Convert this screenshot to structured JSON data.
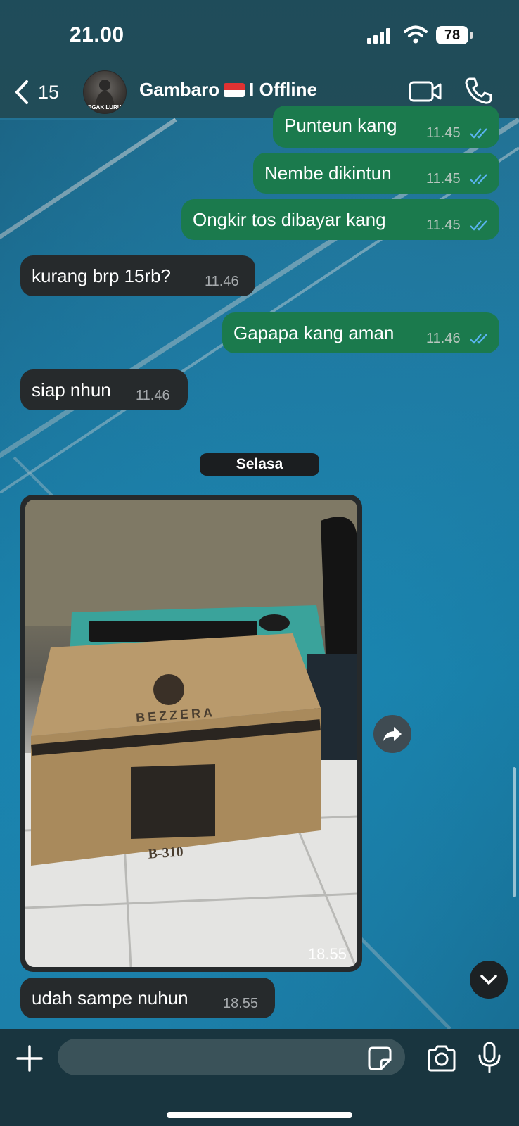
{
  "status_bar": {
    "time": "21.00",
    "battery": "78"
  },
  "header": {
    "back_count": "15",
    "contact_name": "Gambaro",
    "contact_status_suffix": "I Offline",
    "avatar_caption": "TEGAK LURUS"
  },
  "messages": [
    {
      "direction": "out",
      "text": "Punteun kang",
      "time": "11.45"
    },
    {
      "direction": "out",
      "text": "Nembe dikintun",
      "time": "11.45"
    },
    {
      "direction": "out",
      "text": "Ongkir tos dibayar kang",
      "time": "11.45"
    },
    {
      "direction": "in",
      "text": "kurang brp 15rb?",
      "time": "11.46"
    },
    {
      "direction": "out",
      "text": "Gapapa kang aman",
      "time": "11.46"
    },
    {
      "direction": "in",
      "text": "siap nhun",
      "time": "11.46"
    }
  ],
  "day_separator": "Selasa",
  "photo_message": {
    "time": "18.55",
    "box_brand": "BEZZERA",
    "box_model": "B-310"
  },
  "last_message": {
    "direction": "in",
    "text": "udah sampe nuhun",
    "time": "18.55"
  },
  "composer": {
    "placeholder": ""
  },
  "colors": {
    "outgoing_bubble": "#1b7a4d",
    "incoming_bubble": "#262a2c",
    "read_ticks": "#5ab4f0",
    "header_bg": "#214a55"
  }
}
